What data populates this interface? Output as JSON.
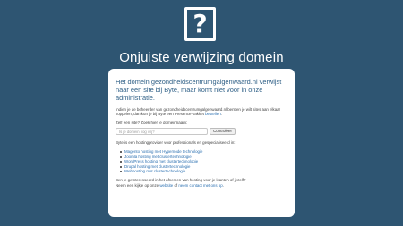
{
  "logo": {
    "glyph": "?"
  },
  "heading": "Onjuiste verwijzing domein",
  "card": {
    "lead": "Het domein gezondheidscentrumgalgenwaard.nl verwijst naar een site bij Byte, maar komt niet voor in onze administratie.",
    "owner_text": "Indien je de beheerder van gezondheidscentrumgalgenwaard.nl bent en je wilt sites aan elkaar koppelen, dan kun je bij Byte een Presence-pakket",
    "owner_link": "bestellen",
    "owner_suffix": ".",
    "search": {
      "label": "Zelf een site? Zoek hier je domeinnaam:",
      "placeholder": "Is je domein nog vrij?",
      "button": "Controleer"
    },
    "provider_intro": "Byte is een hostingprovider voor professionals en gespecialiseerd in:",
    "features": [
      "Magento hosting met Hypernode technologie",
      "Joomla hosting met clustertechnologie",
      "WordPress hosting met clustertechnologie",
      "Drupal hosting met clustertechnologie",
      "Webhosting met clustertechnologie"
    ],
    "closing": {
      "line1": "Ben je geïnteresseerd in het afnemen van hosting voor je klanten of jezelf?",
      "line2_prefix": "Neem een kijkje op onze",
      "website_link": "website",
      "line2_middle": "of",
      "contact_link": "neem contact met ons op",
      "line2_suffix": "."
    }
  }
}
